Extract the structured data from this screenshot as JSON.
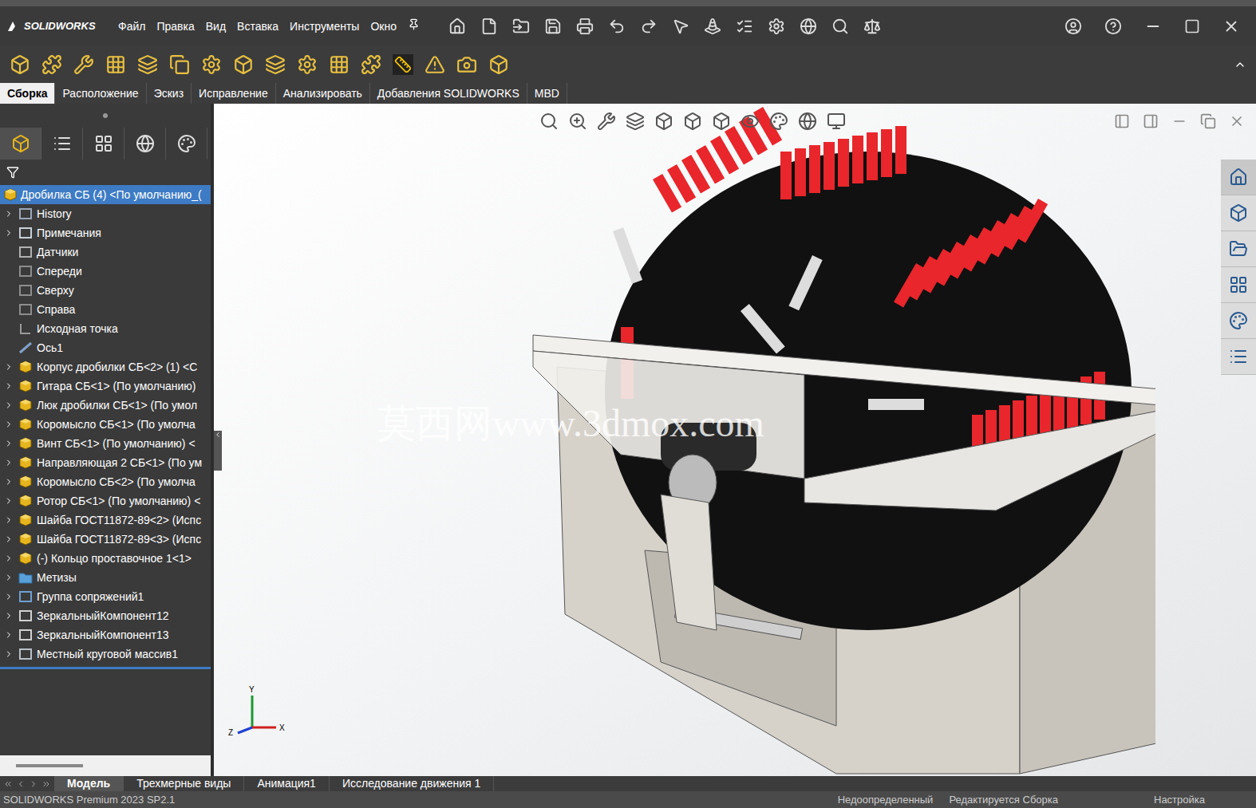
{
  "window": {
    "logo": "SOLIDWORKS",
    "menu": [
      "Файл",
      "Правка",
      "Вид",
      "Вставка",
      "Инструменты",
      "Окно"
    ]
  },
  "tabs": [
    {
      "label": "Сборка",
      "selected": true
    },
    {
      "label": "Расположение",
      "selected": false
    },
    {
      "label": "Эскиз",
      "selected": false
    },
    {
      "label": "Исправление",
      "selected": false
    },
    {
      "label": "Анализировать",
      "selected": false
    },
    {
      "label": "Добавления SOLIDWORKS",
      "selected": false
    },
    {
      "label": "MBD",
      "selected": false
    }
  ],
  "tree": {
    "root": {
      "label": "Дробилка СБ (4) <По умолчанию_(",
      "selected": true
    },
    "items": [
      {
        "label": "History",
        "expandable": true,
        "kind": "history"
      },
      {
        "label": "Примечания",
        "expandable": true,
        "kind": "notes"
      },
      {
        "label": "Датчики",
        "expandable": false,
        "kind": "sensor"
      },
      {
        "label": "Спереди",
        "expandable": false,
        "kind": "plane"
      },
      {
        "label": "Сверху",
        "expandable": false,
        "kind": "plane"
      },
      {
        "label": "Справа",
        "expandable": false,
        "kind": "plane"
      },
      {
        "label": "Исходная точка",
        "expandable": false,
        "kind": "origin"
      },
      {
        "label": "Ось1",
        "expandable": false,
        "kind": "axis"
      },
      {
        "label": "Корпус дробилки СБ<2> (1) <С",
        "expandable": true,
        "kind": "assembly"
      },
      {
        "label": "Гитара СБ<1> (По умолчанию)",
        "expandable": true,
        "kind": "assembly"
      },
      {
        "label": "Люк дробилки СБ<1> (По умол",
        "expandable": true,
        "kind": "assembly"
      },
      {
        "label": "Коромысло СБ<1> (По умолча",
        "expandable": true,
        "kind": "assembly"
      },
      {
        "label": "Винт СБ<1> (По умолчанию) <",
        "expandable": true,
        "kind": "assembly"
      },
      {
        "label": "Направляющая 2 СБ<1> (По ум",
        "expandable": true,
        "kind": "assembly"
      },
      {
        "label": "Коромысло СБ<2> (По умолча",
        "expandable": true,
        "kind": "assembly"
      },
      {
        "label": "Ротор СБ<1> (По умолчанию) <",
        "expandable": true,
        "kind": "assembly"
      },
      {
        "label": "Шайба ГОСТ11872-89<2> (Испс",
        "expandable": true,
        "kind": "assembly"
      },
      {
        "label": "Шайба ГОСТ11872-89<3> (Испс",
        "expandable": true,
        "kind": "assembly"
      },
      {
        "label": "(-) Кольцо проставочное 1<1>",
        "expandable": true,
        "kind": "assembly"
      },
      {
        "label": "Метизы",
        "expandable": true,
        "kind": "folder"
      },
      {
        "label": "Группа сопряжений1",
        "expandable": true,
        "kind": "mates"
      },
      {
        "label": "ЗеркальныйКомпонент12",
        "expandable": true,
        "kind": "mirror"
      },
      {
        "label": "ЗеркальныйКомпонент13",
        "expandable": true,
        "kind": "mirror"
      },
      {
        "label": "Местный круговой массив1",
        "expandable": true,
        "kind": "pattern"
      }
    ]
  },
  "viewport": {
    "watermark": "莫西网www.3dmox.com",
    "axes": [
      "Y",
      "Z",
      "X"
    ]
  },
  "bottom_tabs": [
    {
      "label": "Модель",
      "selected": true
    },
    {
      "label": "Трехмерные виды",
      "selected": false
    },
    {
      "label": "Анимация1",
      "selected": false
    },
    {
      "label": "Исследование движения 1",
      "selected": false
    }
  ],
  "status_bar": {
    "product": "SOLIDWORKS Premium 2023 SP2.1",
    "state": "Недоопределенный",
    "mode": "Редактируется Сборка",
    "settings": "Настройка"
  }
}
